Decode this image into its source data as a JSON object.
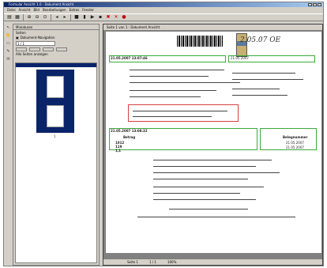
{
  "window": {
    "title": "Formular Ansicht 1.0 - Dokument Ansicht"
  },
  "menu": [
    "Datei",
    "Ansicht",
    "Bild",
    "Bearbeitungen",
    "Extras",
    "Fenster"
  ],
  "panel": {
    "title": "Miniaturen",
    "tab": "Seiten",
    "nav_label": "Dokument-Navigation",
    "page_value": "1 / 1",
    "list_label": "Alle Seiten anzeigen",
    "thumb_label": "1"
  },
  "document": {
    "tab_title": "Seite 1 von 1 - Dokument Ansicht",
    "header_date": "21.05.2007 13:07:46",
    "signature": "2.05.07 OE",
    "stamp_date": "21.05.2007",
    "block_date": "21.05.2007 13:08:32",
    "block_label": "Betrag",
    "block_value1": "1012",
    "block_value2": "119",
    "block_value3": "1,1",
    "right_label": "Belegnummer",
    "right_date1": "21.05.2007",
    "right_date2": "21.05.2007"
  },
  "status": [
    "Seite 1",
    "1 / 1",
    "100%"
  ]
}
